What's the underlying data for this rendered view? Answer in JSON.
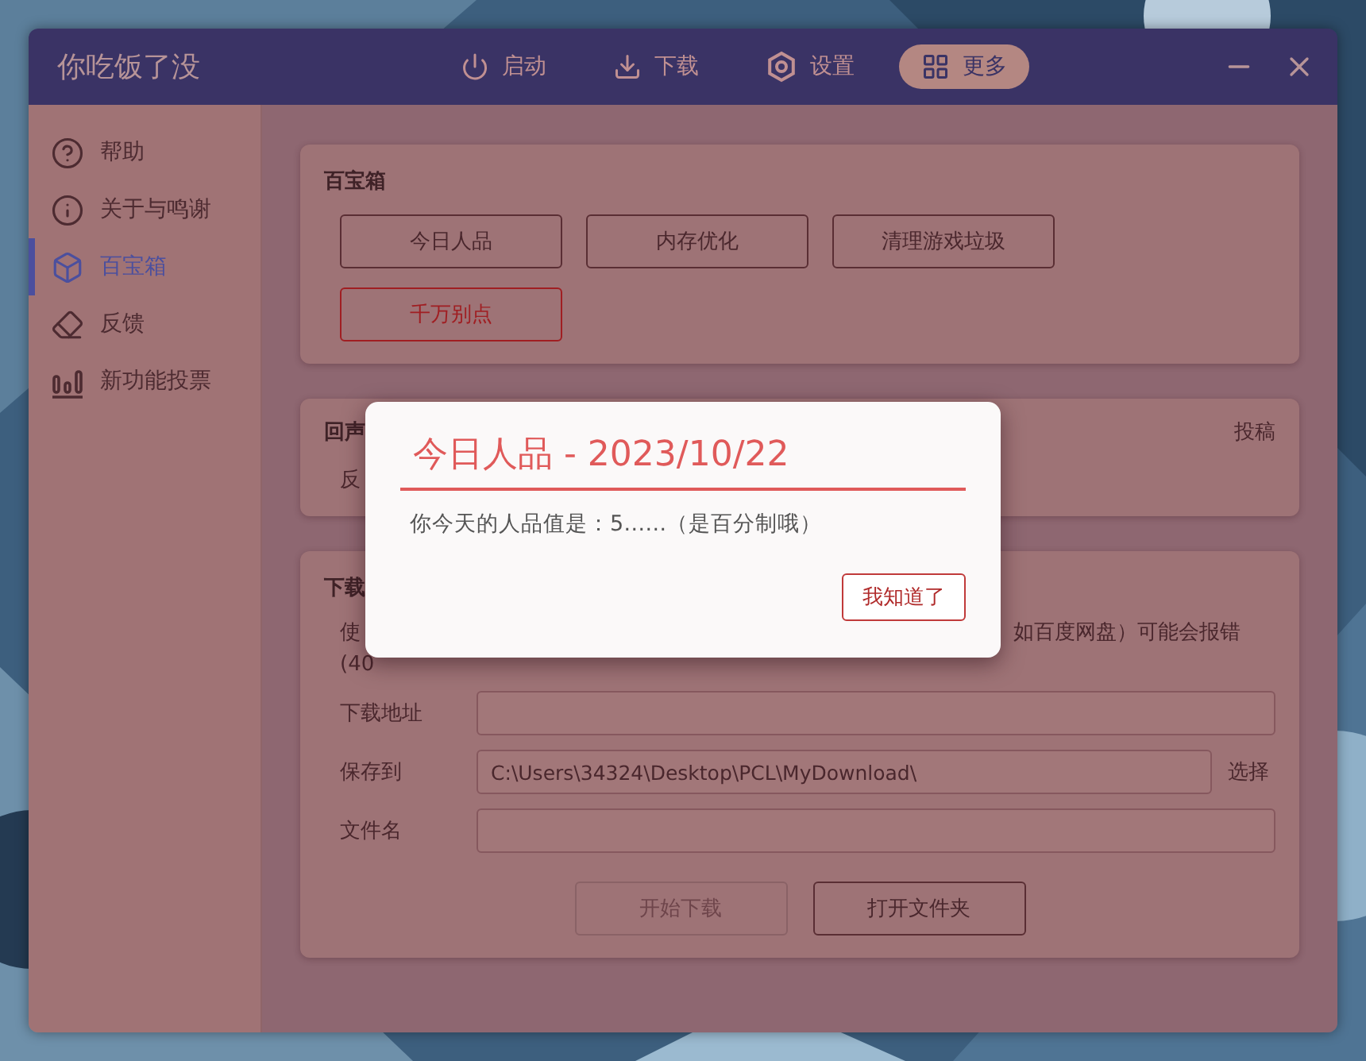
{
  "window": {
    "title": "你吃饭了没"
  },
  "nav": [
    {
      "label": "启动",
      "selected": false
    },
    {
      "label": "下载",
      "selected": false
    },
    {
      "label": "设置",
      "selected": false
    },
    {
      "label": "更多",
      "selected": true
    }
  ],
  "sidebar": [
    {
      "label": "帮助",
      "selected": false
    },
    {
      "label": "关于与鸣谢",
      "selected": false
    },
    {
      "label": "百宝箱",
      "selected": true
    },
    {
      "label": "反馈",
      "selected": false
    },
    {
      "label": "新功能投票",
      "selected": false
    }
  ],
  "toolbox": {
    "title": "百宝箱",
    "buttons": [
      {
        "label": "今日人品",
        "kind": "normal"
      },
      {
        "label": "内存优化",
        "kind": "normal"
      },
      {
        "label": "清理游戏垃圾",
        "kind": "normal"
      },
      {
        "label": "千万别点",
        "kind": "danger"
      }
    ]
  },
  "echo_card": {
    "title": "回声",
    "action": "投稿",
    "text": "反"
  },
  "download_card": {
    "title": "下载",
    "line_start": "使",
    "line_end": "如百度网盘）可能会报错",
    "line2": "(40",
    "fields": [
      {
        "label": "下载地址"
      },
      {
        "label": "保存到",
        "value": "C:\\Users\\34324\\Desktop\\PCL\\MyDownload\\",
        "action": "选择"
      },
      {
        "label": "文件名"
      }
    ],
    "buttons": [
      {
        "label": "开始下载",
        "disabled": true
      },
      {
        "label": "打开文件夹",
        "disabled": false
      }
    ]
  },
  "dialog": {
    "title": "今日人品 - 2023/10/22",
    "message": "你今天的人品值是：5……（是百分制哦）",
    "button": "我知道了"
  }
}
